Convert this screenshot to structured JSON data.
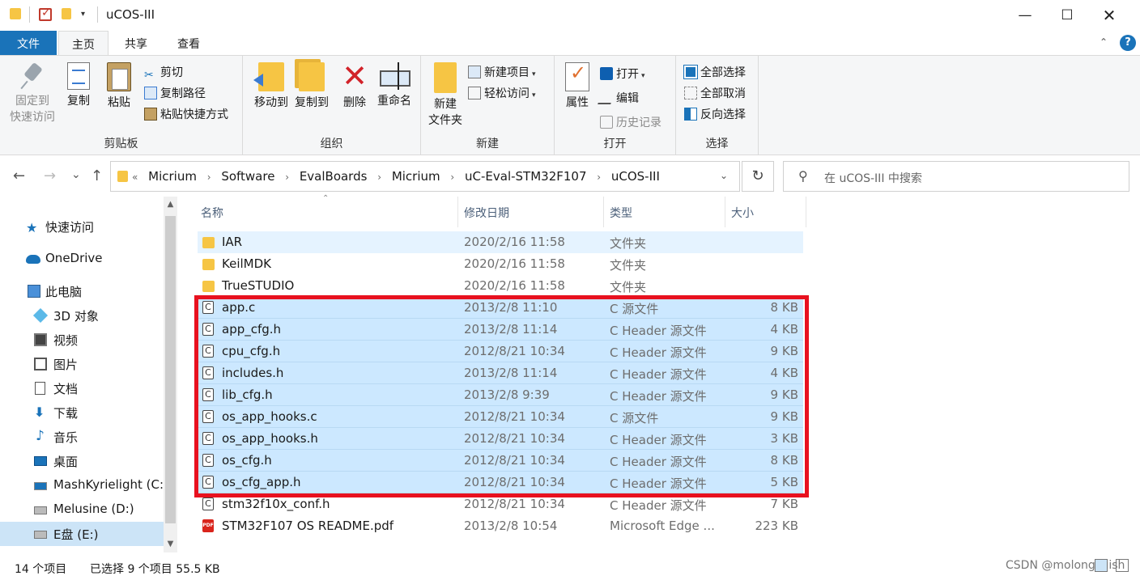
{
  "window": {
    "title": "uCOS-III",
    "controls": {
      "minimize": "—",
      "maximize": "☐",
      "close": "✕"
    }
  },
  "quick_access": {
    "dropdown": "▾"
  },
  "ribbon_tabs": {
    "file": "文件",
    "home": "主页",
    "share": "共享",
    "view": "查看",
    "collapse": "⌃",
    "help": "?"
  },
  "ribbon": {
    "clipboard": {
      "label": "剪贴板",
      "pin_line1": "固定到",
      "pin_line2": "快速访问",
      "copy": "复制",
      "paste": "粘贴",
      "cut": "剪切",
      "copy_path": "复制路径",
      "paste_shortcut": "粘贴快捷方式"
    },
    "organize": {
      "label": "组织",
      "move_to": "移动到",
      "copy_to": "复制到",
      "delete": "删除",
      "rename": "重命名"
    },
    "new": {
      "label": "新建",
      "new_folder_line1": "新建",
      "new_folder_line2": "文件夹",
      "new_item": "新建项目",
      "easy_access": "轻松访问"
    },
    "open": {
      "label": "打开",
      "properties": "属性",
      "open": "打开",
      "edit": "编辑",
      "history": "历史记录"
    },
    "select": {
      "label": "选择",
      "select_all": "全部选择",
      "select_none": "全部取消",
      "invert": "反向选择"
    }
  },
  "address": {
    "back": "←",
    "forward": "→",
    "recent": "⌄",
    "up": "↑",
    "overflow": "«",
    "crumbs": [
      "Micrium",
      "Software",
      "EvalBoards",
      "Micrium",
      "uC-Eval-STM32F107",
      "uCOS-III"
    ],
    "separator": "›",
    "refresh": "↻",
    "search_placeholder": "在 uCOS-III 中搜索"
  },
  "sidebar": {
    "items": [
      {
        "label": "快速访问",
        "icon": "star-icon"
      },
      {
        "label": "OneDrive",
        "icon": "cloud-icon"
      },
      {
        "label": "此电脑",
        "icon": "computer-icon"
      },
      {
        "label": "3D 对象",
        "icon": "cube-icon"
      },
      {
        "label": "视频",
        "icon": "video-icon"
      },
      {
        "label": "图片",
        "icon": "picture-icon"
      },
      {
        "label": "文档",
        "icon": "document-icon"
      },
      {
        "label": "下载",
        "icon": "download-icon"
      },
      {
        "label": "音乐",
        "icon": "music-icon"
      },
      {
        "label": "桌面",
        "icon": "desktop-icon"
      },
      {
        "label": "MashKyrielight (C:)",
        "icon": "windows-drive-icon"
      },
      {
        "label": "Melusine (D:)",
        "icon": "drive-icon"
      },
      {
        "label": "E盘 (E:)",
        "icon": "drive-icon"
      }
    ]
  },
  "columns": {
    "name": "名称",
    "date": "修改日期",
    "type": "类型",
    "size": "大小"
  },
  "files": [
    {
      "name": "IAR",
      "date": "2020/2/16 11:58",
      "type": "文件夹",
      "size": "",
      "icon": "folder"
    },
    {
      "name": "KeilMDK",
      "date": "2020/2/16 11:58",
      "type": "文件夹",
      "size": "",
      "icon": "folder"
    },
    {
      "name": "TrueSTUDIO",
      "date": "2020/2/16 11:58",
      "type": "文件夹",
      "size": "",
      "icon": "folder"
    },
    {
      "name": "app.c",
      "date": "2013/2/8 11:10",
      "type": "C 源文件",
      "size": "8 KB",
      "icon": "c-file"
    },
    {
      "name": "app_cfg.h",
      "date": "2013/2/8 11:14",
      "type": "C Header 源文件",
      "size": "4 KB",
      "icon": "c-file"
    },
    {
      "name": "cpu_cfg.h",
      "date": "2012/8/21 10:34",
      "type": "C Header 源文件",
      "size": "9 KB",
      "icon": "c-file"
    },
    {
      "name": "includes.h",
      "date": "2013/2/8 11:14",
      "type": "C Header 源文件",
      "size": "4 KB",
      "icon": "c-file"
    },
    {
      "name": "lib_cfg.h",
      "date": "2013/2/8 9:39",
      "type": "C Header 源文件",
      "size": "9 KB",
      "icon": "c-file"
    },
    {
      "name": "os_app_hooks.c",
      "date": "2012/8/21 10:34",
      "type": "C 源文件",
      "size": "9 KB",
      "icon": "c-file"
    },
    {
      "name": "os_app_hooks.h",
      "date": "2012/8/21 10:34",
      "type": "C Header 源文件",
      "size": "3 KB",
      "icon": "c-file"
    },
    {
      "name": "os_cfg.h",
      "date": "2012/8/21 10:34",
      "type": "C Header 源文件",
      "size": "8 KB",
      "icon": "c-file"
    },
    {
      "name": "os_cfg_app.h",
      "date": "2012/8/21 10:34",
      "type": "C Header 源文件",
      "size": "5 KB",
      "icon": "c-file"
    },
    {
      "name": "stm32f10x_conf.h",
      "date": "2012/8/21 10:34",
      "type": "C Header 源文件",
      "size": "7 KB",
      "icon": "c-file"
    },
    {
      "name": "STM32F107 OS README.pdf",
      "date": "2013/2/8 10:54",
      "type": "Microsoft Edge ...",
      "size": "223 KB",
      "icon": "pdf"
    }
  ],
  "status": {
    "count": "14 个项目",
    "selection": "已选择 9 个项目  55.5 KB",
    "watermark": "CSDN @molongcuish"
  },
  "colors": {
    "accent": "#1a73b9",
    "selection": "#cce8ff",
    "highlight_border": "#e8111f"
  }
}
